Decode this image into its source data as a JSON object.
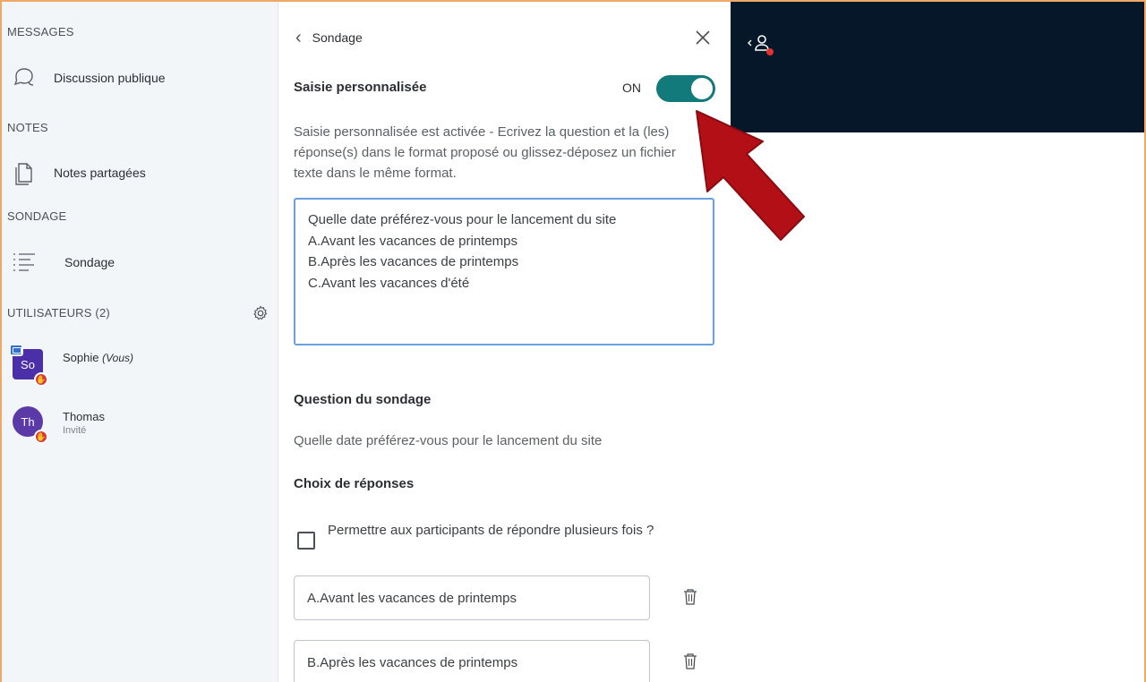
{
  "sidebar": {
    "messages_title": "MESSAGES",
    "public_chat": "Discussion publique",
    "notes_title": "NOTES",
    "shared_notes": "Notes partagées",
    "poll_title": "SONDAGE",
    "poll_item": "Sondage",
    "users_title": "UTILISATEURS (2)",
    "users": [
      {
        "initials": "So",
        "name": "Sophie",
        "you_tag": "(Vous)",
        "role": "",
        "presenter": true
      },
      {
        "initials": "Th",
        "name": "Thomas",
        "you_tag": "",
        "role": "Invité",
        "presenter": false
      }
    ]
  },
  "poll": {
    "back_label": "Sondage",
    "custom_input_label": "Saisie personnalisée",
    "toggle_state": "ON",
    "toggle_on": true,
    "description": "Saisie personnalisée est activée - Ecrivez la question et la (les) réponse(s) dans le format proposé ou glissez-déposez un fichier texte dans le même format.",
    "textarea_value": "Quelle date préférez-vous pour le lancement du site\nA.Avant les vacances de printemps\nB.Après les vacances de printemps\nC.Avant les vacances d'été",
    "question_label": "Question du sondage",
    "question_text": "Quelle date préférez-vous pour le lancement du site",
    "choices_label": "Choix de réponses",
    "multiple_label": "Permettre aux participants de répondre plusieurs fois ?",
    "answers": [
      "A.Avant les vacances de printemps",
      "B.Après les vacances de printemps"
    ]
  },
  "colors": {
    "accent": "#127a7a",
    "frame": "#f0a867",
    "dark_bar": "#06172a",
    "annotation_arrow": "#c4121a",
    "avatar": "#4a2fa8",
    "textarea_focus": "#6aa0de"
  },
  "icons": [
    "chat-icon",
    "notes-icon",
    "poll-list-icon",
    "gear-icon",
    "presenter-icon",
    "raise-hand-icon",
    "back-chevron-icon",
    "close-icon",
    "trash-icon",
    "user-list-icon"
  ]
}
